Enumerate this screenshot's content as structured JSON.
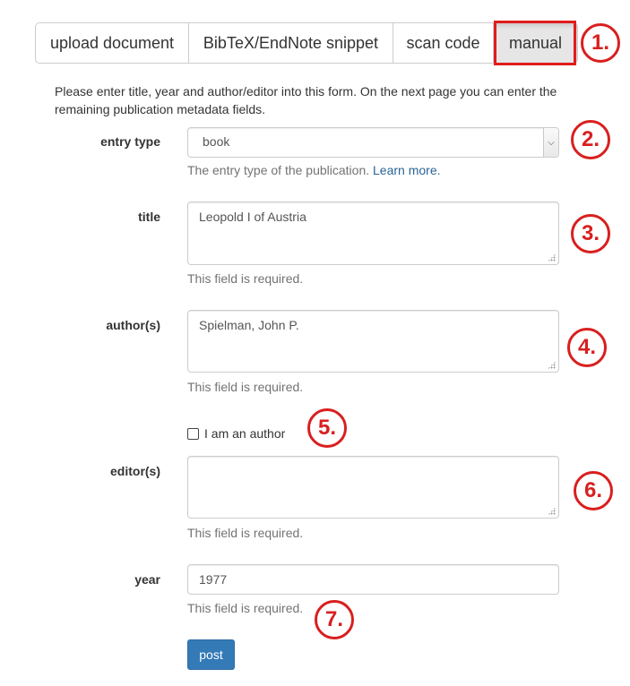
{
  "tabs": [
    {
      "label": "upload document"
    },
    {
      "label": "BibTeX/EndNote snippet"
    },
    {
      "label": "scan code"
    },
    {
      "label": "manual",
      "active": true
    }
  ],
  "intro_text": "Please enter title, year and author/editor into this form. On the next page you can enter the remaining publication metadata fields.",
  "form": {
    "entry_type": {
      "label": "entry type",
      "value": "book",
      "help": "The entry type of the publication.",
      "help_link": "Learn more."
    },
    "title": {
      "label": "title",
      "value": "Leopold I of Austria",
      "help": "This field is required."
    },
    "authors": {
      "label": "author(s)",
      "value": "Spielman, John P.",
      "help": "This field is required."
    },
    "i_am_author": {
      "label": "I am an author",
      "checked": false
    },
    "editors": {
      "label": "editor(s)",
      "value": "",
      "help": "This field is required."
    },
    "year": {
      "label": "year",
      "value": "1977",
      "help": "This field is required."
    },
    "post_label": "post"
  },
  "markers": [
    "1.",
    "2.",
    "3.",
    "4.",
    "5.",
    "6.",
    "7."
  ],
  "colors": {
    "annotation_red": "#d91f1f",
    "primary_button": "#337ab7",
    "link": "#2a6496"
  }
}
